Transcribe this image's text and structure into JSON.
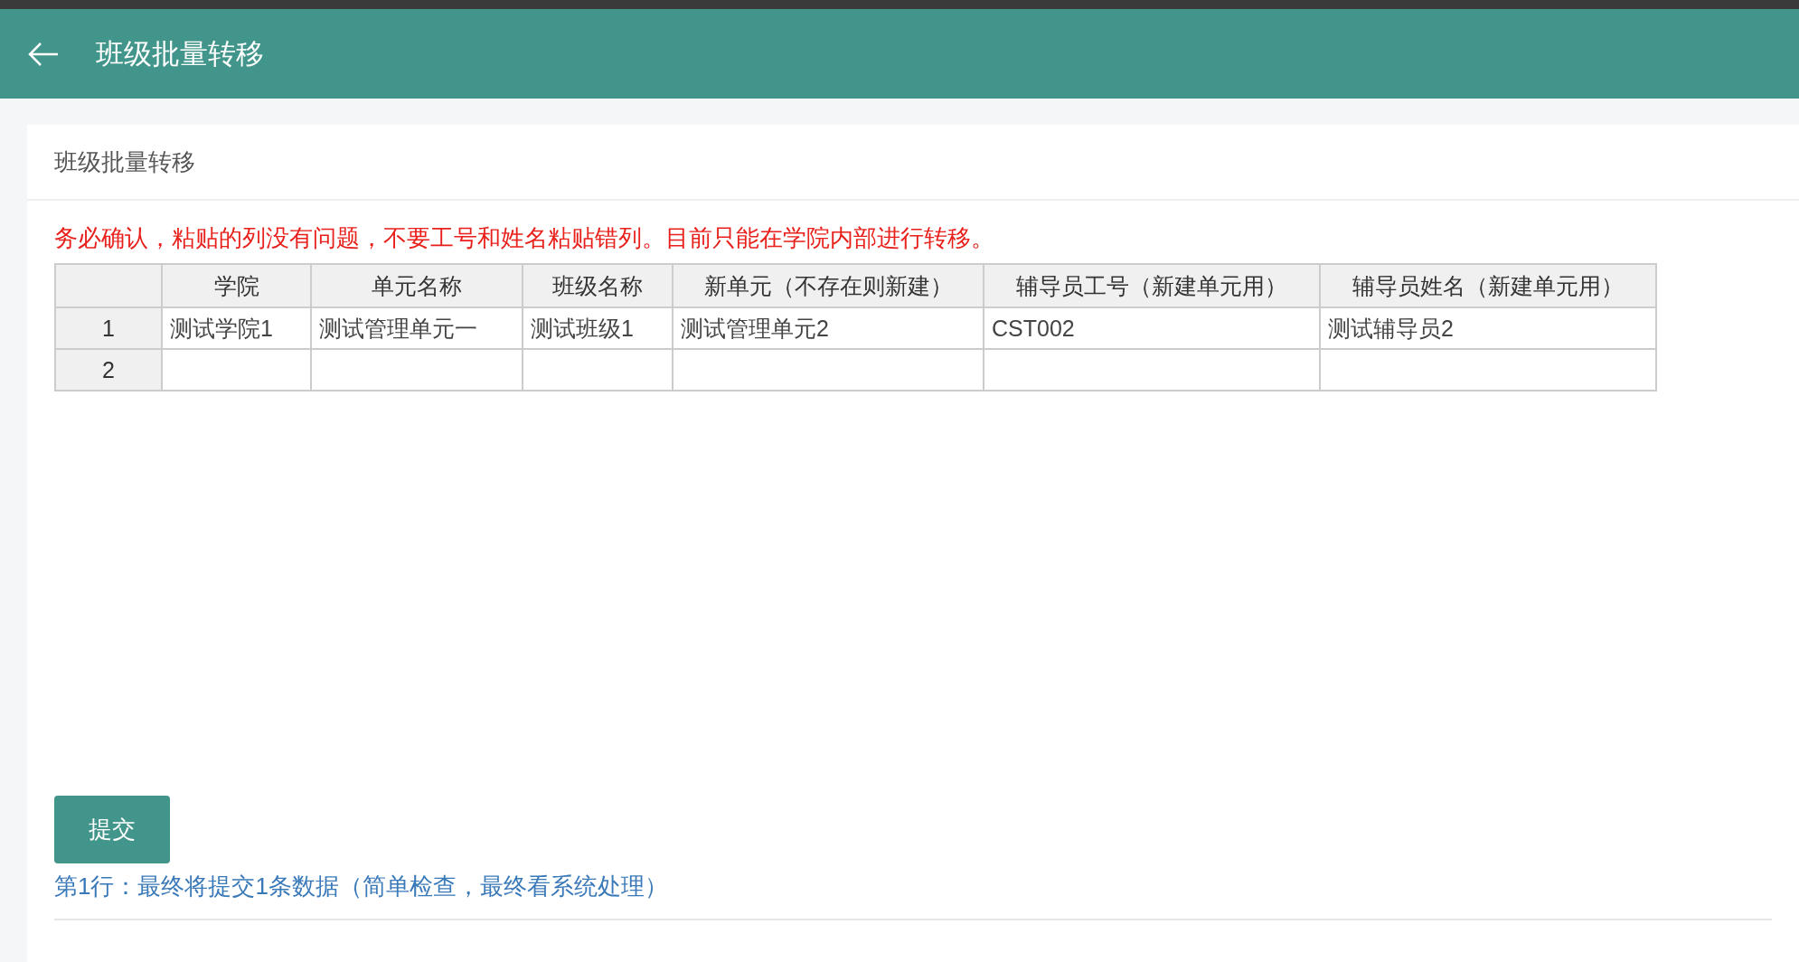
{
  "header": {
    "title": "班级批量转移"
  },
  "card": {
    "title": "班级批量转移",
    "warning": "务必确认，粘贴的列没有问题，不要工号和姓名粘贴错列。目前只能在学院内部进行转移。"
  },
  "table": {
    "columns": [
      "学院",
      "单元名称",
      "班级名称",
      "新单元（不存在则新建）",
      "辅导员工号（新建单元用）",
      "辅导员姓名（新建单元用）"
    ],
    "rows": [
      {
        "number": "1",
        "cells": [
          "测试学院1",
          "测试管理单元一",
          "测试班级1",
          "测试管理单元2",
          "CST002",
          "测试辅导员2"
        ]
      },
      {
        "number": "2",
        "cells": []
      }
    ]
  },
  "submit_button": "提交",
  "result_message": "第1行：最终将提交1条数据（简单检查，最终看系统处理）"
}
